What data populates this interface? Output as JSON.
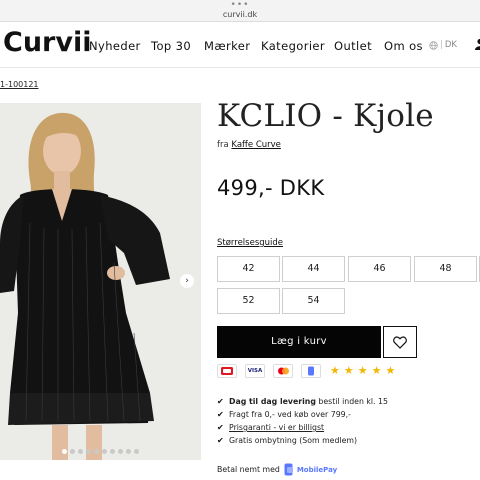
{
  "browser": {
    "dots": "•••",
    "url": "curvii.dk"
  },
  "header": {
    "logo": "Curvii",
    "nav": [
      "Nyheder",
      "Top 30",
      "Mærker",
      "Kategorier",
      "Outlet",
      "Om os"
    ],
    "lang": "DK"
  },
  "breadcrumb": "1-100121",
  "gallery": {
    "images": 10,
    "active_index": 0,
    "next_arrow": "›"
  },
  "product": {
    "title": "KCLIO - Kjole",
    "brand_prefix": "fra",
    "brand": "Kaffe Curve",
    "price": "499,- DKK",
    "size_guide": "Størrelsesguide",
    "sizes": [
      "42",
      "44",
      "46",
      "48",
      "50",
      "52",
      "54"
    ],
    "add_to_cart": "Læg i kurv"
  },
  "payment": {
    "methods": [
      "Dankort",
      "VISA",
      "Mastercard",
      "MobilePay"
    ],
    "rating_stars": 5,
    "star_color": "#f2b705"
  },
  "usps": [
    {
      "bold": "Dag til dag levering",
      "rest": " bestil inden kl. 15"
    },
    {
      "bold": "",
      "rest": "Fragt fra 0,- ved køb over 799,-"
    },
    {
      "link": "Prisgaranti - vi er billigst"
    },
    {
      "bold": "",
      "rest": "Gratis ombytning (Som medlem)"
    }
  ],
  "mobilepay": {
    "text": "Betal nemt med",
    "logo": "MobilePay"
  },
  "colors": {
    "cart_bg": "#050505",
    "accent_blue": "#5a78ff"
  }
}
